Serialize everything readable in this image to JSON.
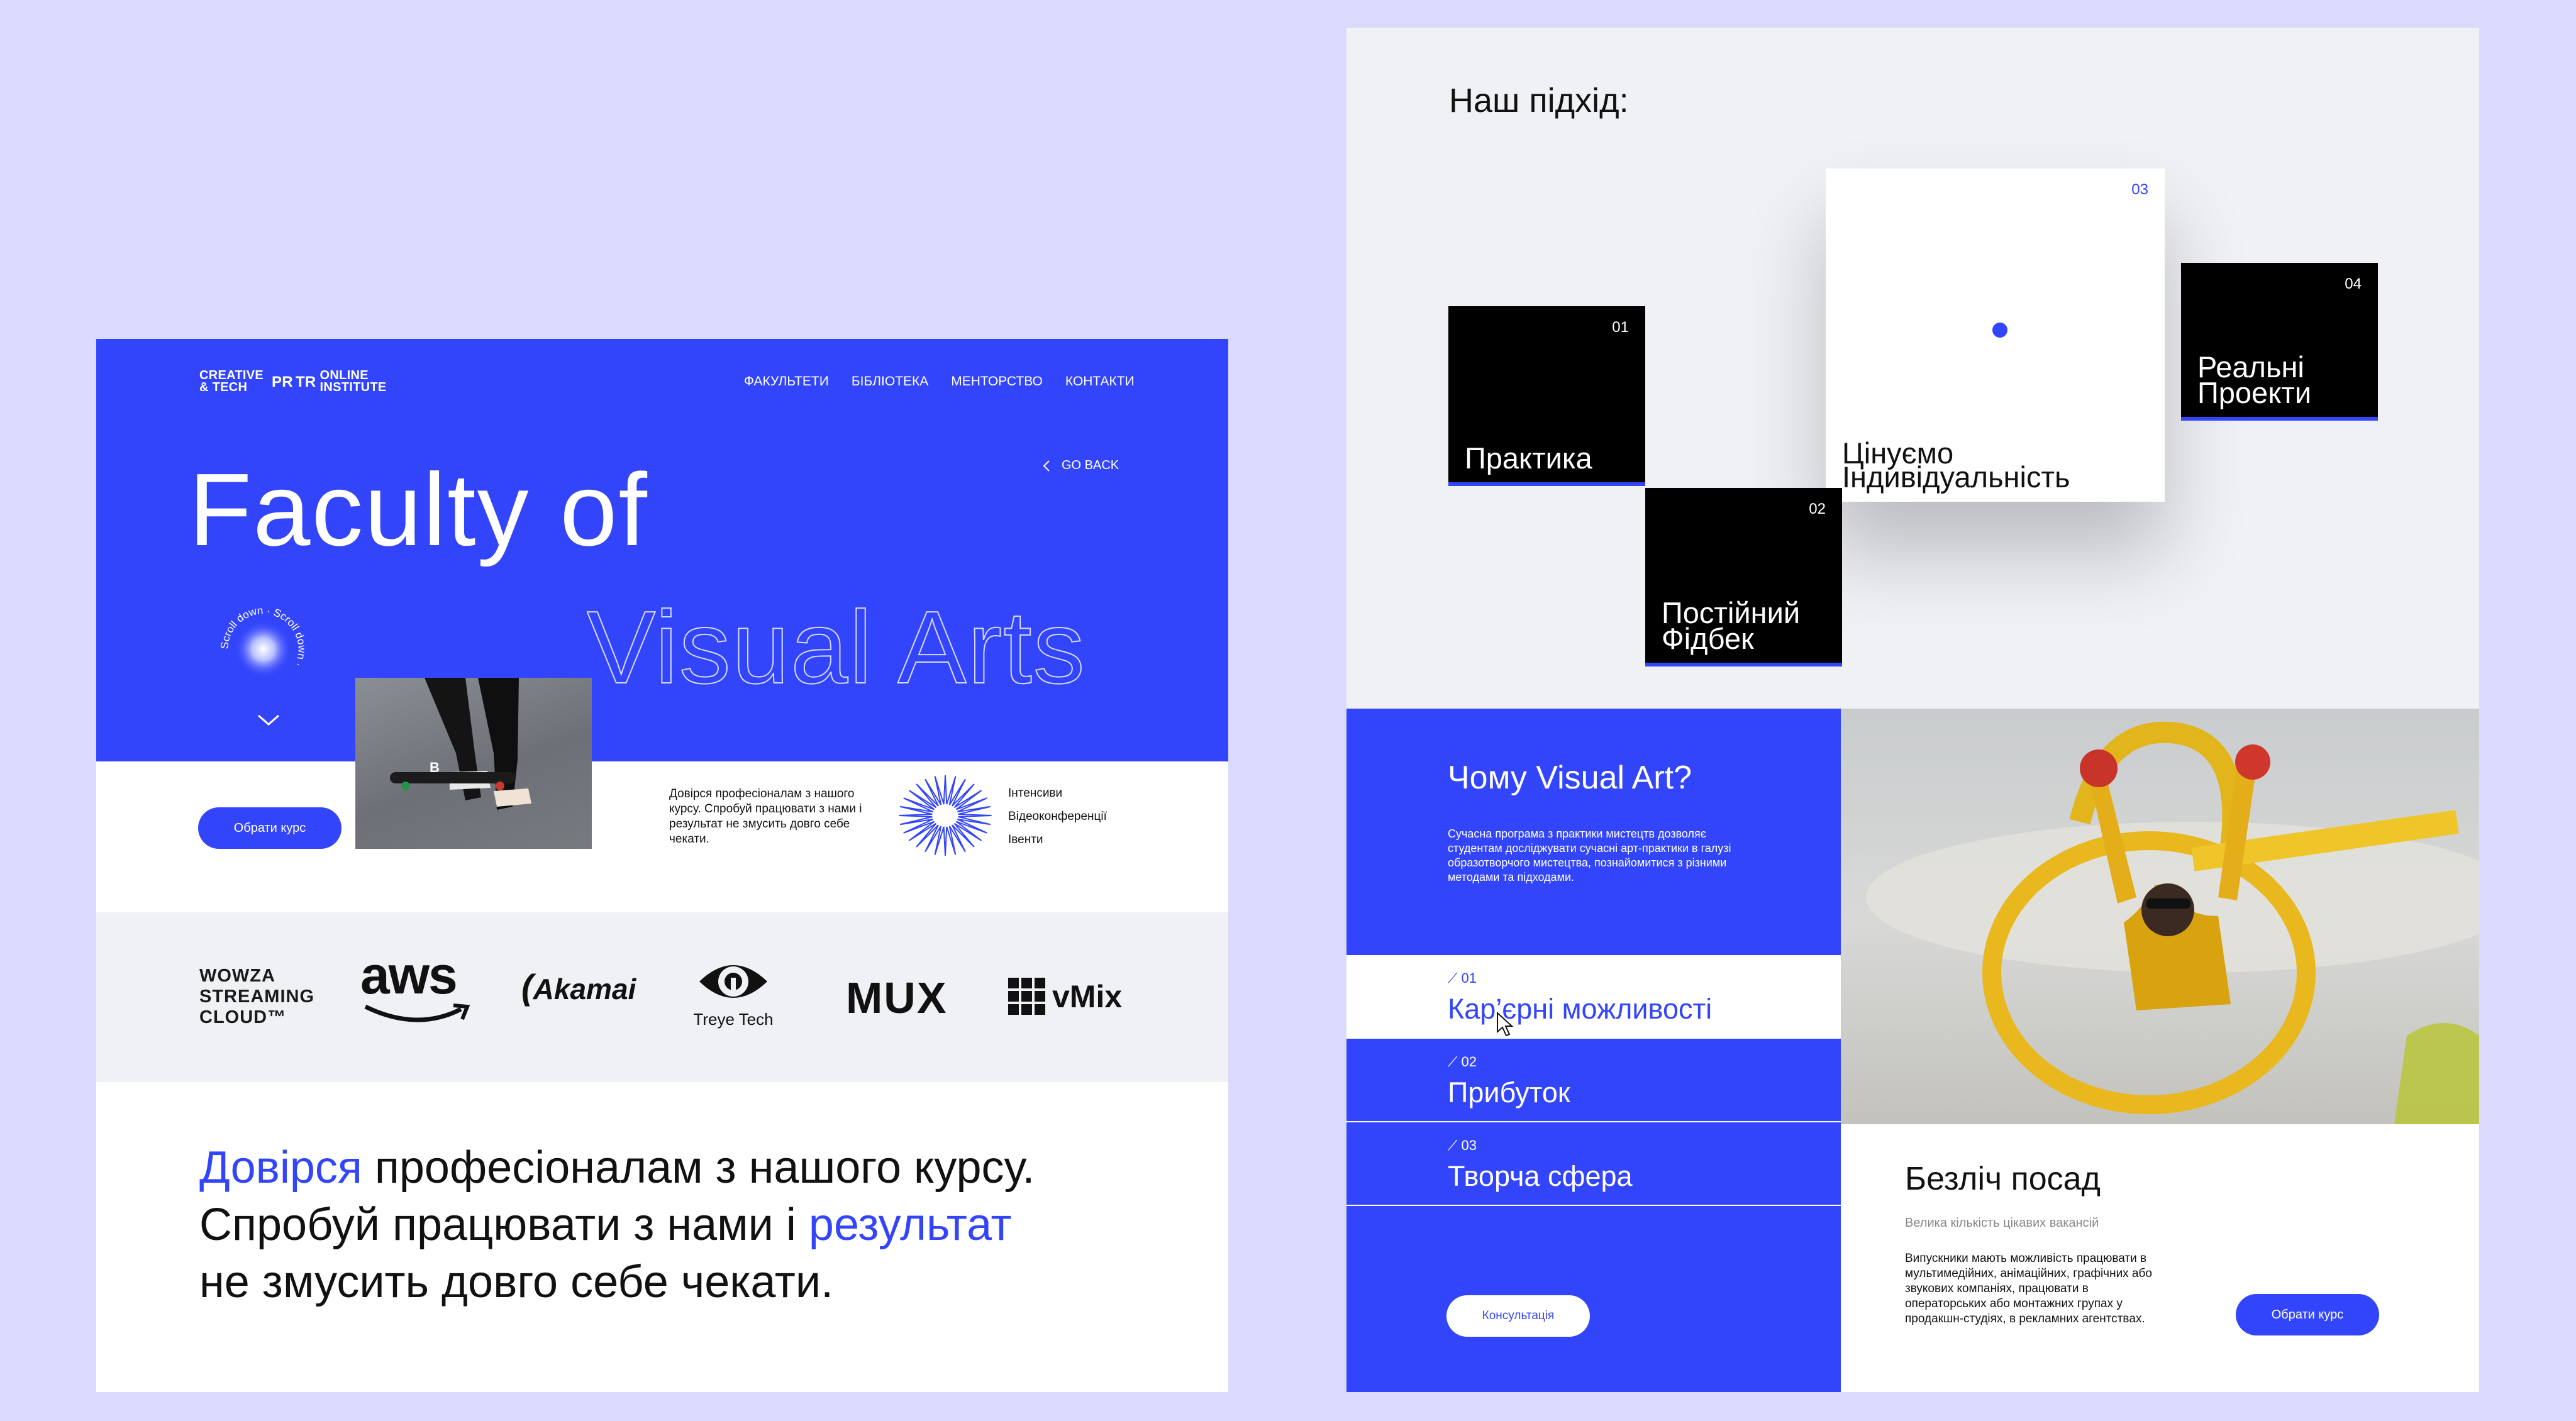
{
  "left_page": {
    "logo": {
      "line1": "CREATIVE",
      "line2": "& TECH",
      "mark": "PR",
      "mark_r": "TR",
      "line3": "ONLINE",
      "line4": "INSTITUTE"
    },
    "nav": [
      "ФАКУЛЬТЕТИ",
      "БІБЛІОТЕКА",
      "МЕНТОРСТВО",
      "КОНТАКТИ"
    ],
    "go_back": "GO BACK",
    "hero_title_line1": "Faculty of",
    "hero_title_line2": "Visual Arts",
    "scroll_badge_text": "Scroll down · Scroll down ·",
    "choose_course_button": "Обрати курс",
    "trust_small": "Довірся професіоналам з нашого курсу. Спробуй працювати з нами і результат не змусить довго себе чекати.",
    "features": [
      "Інтенсиви",
      "Відеоконференції",
      "Івенти"
    ],
    "partners": {
      "wowza": [
        "WOWZA",
        "STREAMING",
        "CLOUD™"
      ],
      "aws": "aws",
      "akamai": "Akamai",
      "treye": "Treye Tech",
      "mux": "MUX",
      "vmix": "vMix"
    },
    "trust_big": {
      "w1": "Довірся",
      "t1": " професіоналам з нашого курсу.",
      "t2": "Спробуй працювати з нами і ",
      "w2": "результат",
      "t3": "не змусить довго себе чекати."
    }
  },
  "approach": {
    "title": "Наш підхід:",
    "cards": [
      {
        "num": "01",
        "label": "Практика"
      },
      {
        "num": "02",
        "label_l1": "Постійний",
        "label_l2": "Фідбек"
      },
      {
        "num": "03",
        "label_l1": "Цінуємо",
        "label_l2": "Індивідуальність"
      },
      {
        "num": "04",
        "label_l1": "Реальні",
        "label_l2": "Проекти"
      }
    ]
  },
  "why": {
    "title": "Чому Visual Art?",
    "description": "Сучасна програма з практики мистецтв дозволяє студентам досліджувати сучасні арт-практики в галузі образотворчого мистецтва, познайомитися з різними методами та підходами.",
    "items": [
      {
        "num": "01",
        "label": "Кар’єрні можливості"
      },
      {
        "num": "02",
        "label": "Прибуток"
      },
      {
        "num": "03",
        "label": "Творча сфера"
      }
    ],
    "consult_button": "Консультація"
  },
  "positions": {
    "title": "Безліч посад",
    "subtitle": "Велика кількість цікавих вакансій",
    "description": "Випускники мають можливість працювати в мультимедійних, анімаційних, графічних або звукових компаніях, працювати в операторських або монтажних групах у продакшн-студіях, в рекламних агентствах.",
    "button": "Обрати курс"
  },
  "colors": {
    "accent": "#3345fb",
    "background": "#dadafd",
    "panel_gray": "#f0f1f5"
  }
}
